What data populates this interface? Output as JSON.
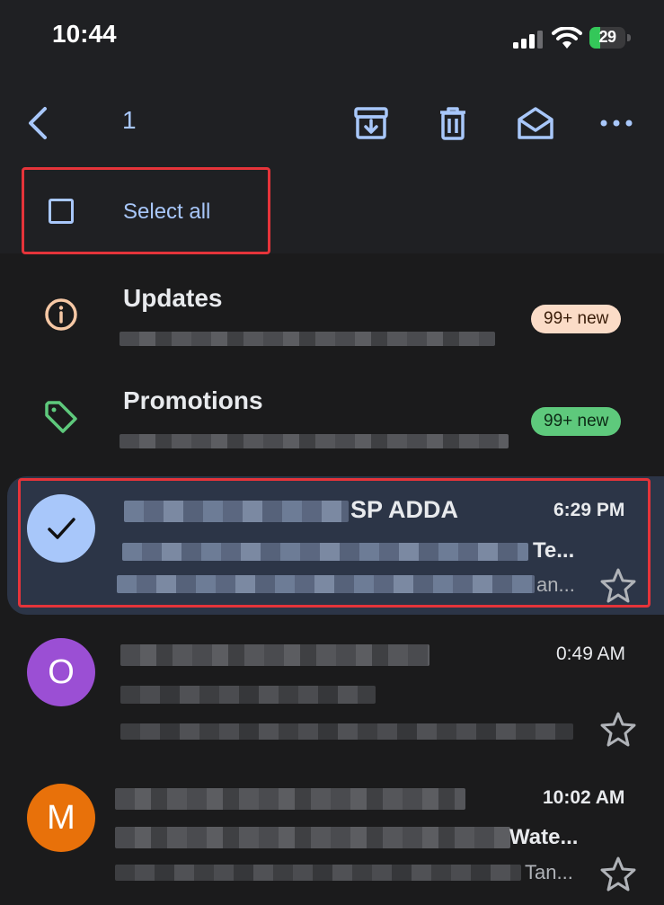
{
  "status_bar": {
    "time": "10:44",
    "battery_level": "29",
    "battery_fraction": 0.29,
    "icons": [
      "signal-icon",
      "wifi-icon",
      "battery-icon"
    ]
  },
  "toolbar": {
    "selected_count": "1",
    "icons": [
      "back-arrow-icon",
      "archive-icon",
      "trash-icon",
      "mark-read-icon",
      "more-icon"
    ],
    "select_all_label": "Select all"
  },
  "categories": [
    {
      "title": "Updates",
      "badge": "99+ new",
      "icon": "info-icon",
      "icon_color": "#f6c8a5",
      "badge_bg": "#fbdcc7"
    },
    {
      "title": "Promotions",
      "badge": "99+ new",
      "icon": "tag-icon",
      "icon_color": "#5ec97c",
      "badge_bg": "#5ec97c"
    }
  ],
  "emails": [
    {
      "sender": "SP ADDA",
      "time": "6:29 PM",
      "subject": "Te...",
      "snippet_tail": "an...",
      "selected": true,
      "avatar": "check-icon"
    },
    {
      "sender": "",
      "time": "0:49 AM",
      "subject": "",
      "avatar_letter": "O",
      "avatar_color": "#9b4fd4",
      "selected": false
    },
    {
      "sender": "",
      "time": "10:02 AM",
      "subject": "Wate...",
      "snippet_tail": "Tan...",
      "avatar_letter": "M",
      "avatar_color": "#e8710a",
      "selected": false
    }
  ],
  "colors": {
    "accent": "#a8c7fa",
    "highlight_border": "#e5343a",
    "selected_row_bg": "#2c3547"
  }
}
